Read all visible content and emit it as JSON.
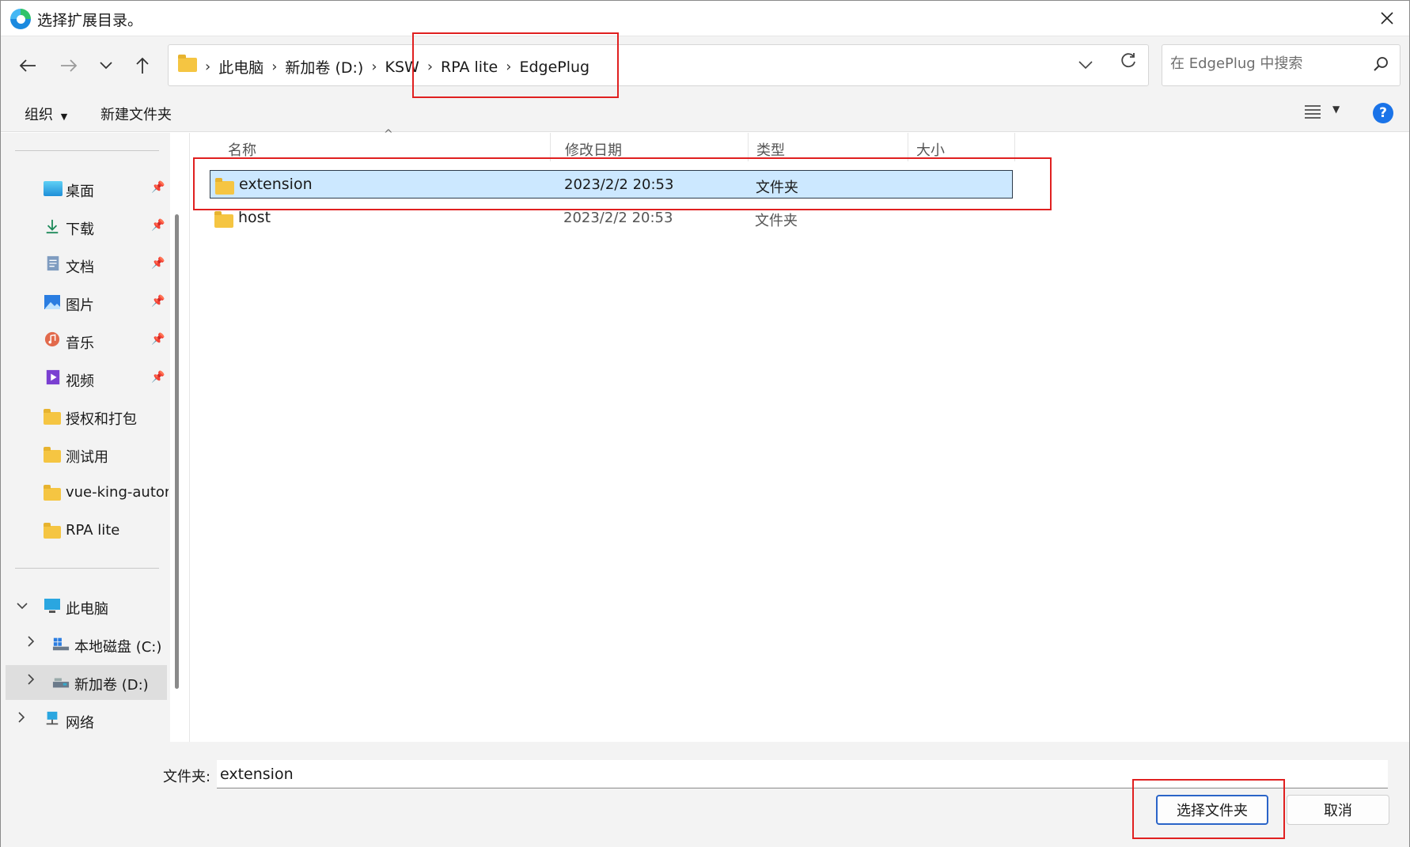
{
  "dialog": {
    "title": "选择扩展目录。"
  },
  "address": {
    "crumbs": [
      "此电脑",
      "新加卷 (D:)",
      "KSW",
      "RPA lite",
      "EdgePlug"
    ]
  },
  "search": {
    "placeholder": "在 EdgePlug 中搜索"
  },
  "toolbar": {
    "organize": "组织",
    "new_folder": "新建文件夹",
    "help": "?"
  },
  "sidebar": {
    "quick_access": [
      {
        "label": "桌面",
        "icon": "desktop-icon",
        "pinned": true
      },
      {
        "label": "下载",
        "icon": "download-icon",
        "pinned": true
      },
      {
        "label": "文档",
        "icon": "document-icon",
        "pinned": true
      },
      {
        "label": "图片",
        "icon": "pictures-icon",
        "pinned": true
      },
      {
        "label": "音乐",
        "icon": "music-icon",
        "pinned": true
      },
      {
        "label": "视频",
        "icon": "video-icon",
        "pinned": true
      },
      {
        "label": "授权和打包",
        "icon": "folder-icon",
        "pinned": false
      },
      {
        "label": "测试用",
        "icon": "folder-icon",
        "pinned": false
      },
      {
        "label": "vue-king-autor",
        "icon": "folder-icon",
        "pinned": false
      },
      {
        "label": "RPA lite",
        "icon": "folder-icon",
        "pinned": false
      }
    ],
    "this_pc": "此电脑",
    "drives": [
      "本地磁盘 (C:)",
      "新加卷 (D:)"
    ],
    "network": "网络"
  },
  "columns": {
    "name": "名称",
    "modified": "修改日期",
    "type": "类型",
    "size": "大小"
  },
  "files": [
    {
      "name": "extension",
      "modified": "2023/2/2 20:53",
      "type": "文件夹",
      "selected": true
    },
    {
      "name": "host",
      "modified": "2023/2/2 20:53",
      "type": "文件夹",
      "selected": false
    }
  ],
  "bottom": {
    "folder_label": "文件夹:",
    "folder_value": "extension",
    "select_button": "选择文件夹",
    "cancel_button": "取消"
  },
  "colors": {
    "selection": "#cce8ff",
    "accent": "#1a73e8",
    "annotation": "#e02020",
    "folder": "#f5c542"
  }
}
